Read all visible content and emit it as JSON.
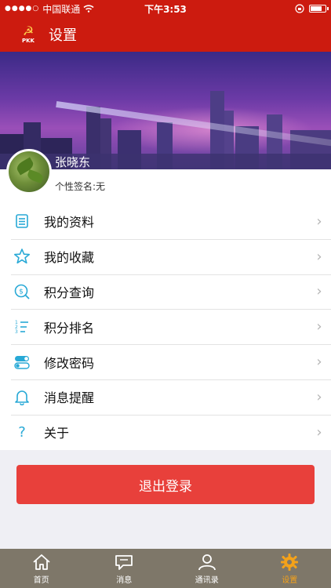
{
  "status_bar": {
    "carrier": "中国联通",
    "time": "下午3:53",
    "battery_level": 0.75
  },
  "nav": {
    "title": "设置",
    "logo_text": "PKK"
  },
  "profile": {
    "name": "张晓东",
    "signature": "个性签名:无"
  },
  "menu": {
    "items": [
      {
        "label": "我的资料",
        "icon": "profile-list-icon"
      },
      {
        "label": "我的收藏",
        "icon": "star-icon"
      },
      {
        "label": "积分查询",
        "icon": "points-search-icon"
      },
      {
        "label": "积分排名",
        "icon": "ranking-list-icon"
      },
      {
        "label": "修改密码",
        "icon": "toggle-icon"
      },
      {
        "label": "消息提醒",
        "icon": "bell-icon"
      },
      {
        "label": "关于",
        "icon": "question-icon"
      }
    ]
  },
  "logout_label": "退出登录",
  "tabs": [
    {
      "label": "首页",
      "icon": "home-icon"
    },
    {
      "label": "消息",
      "icon": "chat-icon"
    },
    {
      "label": "通讯录",
      "icon": "contacts-icon"
    },
    {
      "label": "设置",
      "icon": "gear-icon",
      "active": true
    }
  ],
  "colors": {
    "brand_red": "#cc1b0f",
    "accent_teal": "#28a9d6",
    "logout_red": "#e8403b",
    "tab_bg": "#7e7769",
    "tab_active": "#f4a21a"
  }
}
